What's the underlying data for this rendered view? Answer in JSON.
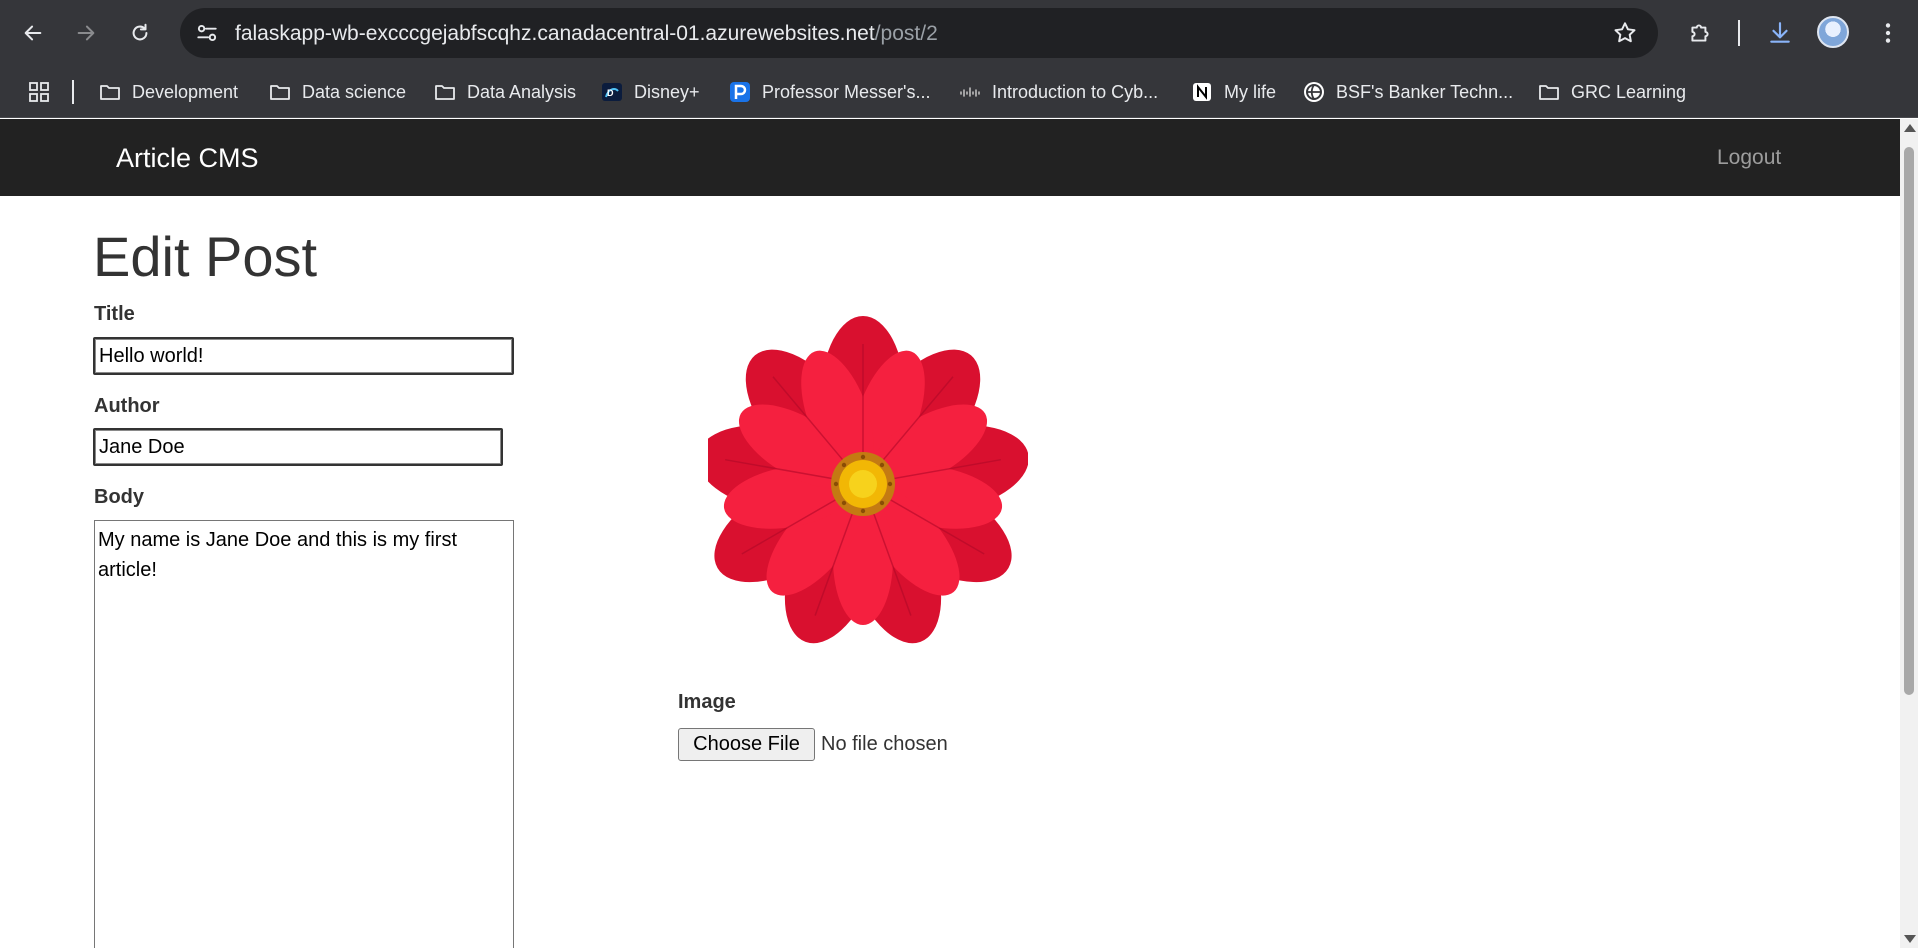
{
  "browser": {
    "url_host": "falaskapp-wb-excccgejabfscqhz.canadacentral-01.azurewebsites.net",
    "url_path": "/post/2",
    "bookmarks": [
      {
        "label": "Development",
        "icon": "folder-icon"
      },
      {
        "label": "Data science",
        "icon": "folder-icon"
      },
      {
        "label": "Data Analysis",
        "icon": "folder-icon"
      },
      {
        "label": "Disney+",
        "icon": "disney-plus-icon"
      },
      {
        "label": "Professor Messer's...",
        "icon": "professor-messer-icon"
      },
      {
        "label": "Introduction to Cyb...",
        "icon": "cisco-icon"
      },
      {
        "label": "My life",
        "icon": "notion-icon"
      },
      {
        "label": "BSF's Banker Techn...",
        "icon": "globe-icon"
      },
      {
        "label": "GRC Learning",
        "icon": "folder-icon"
      }
    ]
  },
  "app": {
    "brand": "Article CMS",
    "logout_label": "Logout"
  },
  "form": {
    "page_title": "Edit Post",
    "title_label": "Title",
    "title_value": "Hello world!",
    "author_label": "Author",
    "author_value": "Jane Doe",
    "body_label": "Body",
    "body_value": "My name is Jane Doe and this is my first article!",
    "image_label": "Image",
    "image_alt": "red-flower-image",
    "choose_file_label": "Choose File",
    "file_status": "No file chosen"
  },
  "colors": {
    "chrome_bg": "#35363a",
    "omnibox_bg": "#202124",
    "navbar_bg": "#222222",
    "flower_red": "#e8173a"
  }
}
